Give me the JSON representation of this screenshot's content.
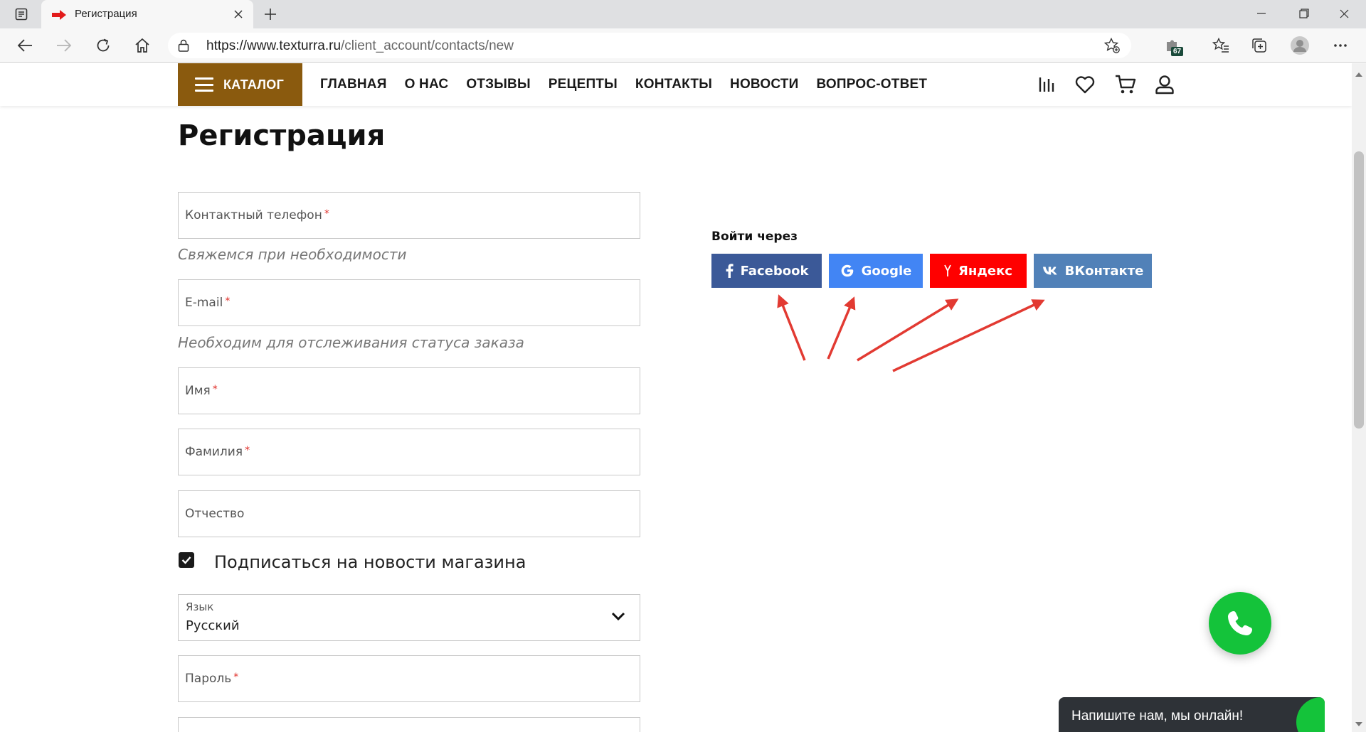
{
  "browser": {
    "tab_title": "Регистрация",
    "url_host": "https://www.texturra.ru",
    "url_path": "/client_account/contacts/new",
    "extension_badge": "67"
  },
  "header": {
    "catalog_label": "КАТАЛОГ",
    "nav": [
      "ГЛАВНАЯ",
      "О НАС",
      "ОТЗЫВЫ",
      "РЕЦЕПТЫ",
      "КОНТАКТЫ",
      "НОВОСТИ",
      "ВОПРОС-ОТВЕТ"
    ],
    "accent_color": "#8a5a0e"
  },
  "page": {
    "title": "Регистрация",
    "form": {
      "phone_placeholder": "Контактный телефон",
      "phone_hint": "Свяжемся при необходимости",
      "email_placeholder": "E-mail",
      "email_hint": "Необходим для отслеживания статуса заказа",
      "first_name_placeholder": "Имя",
      "last_name_placeholder": "Фамилия",
      "middle_name_placeholder": "Отчество",
      "required_mark": "*",
      "subscribe_label": "Подписаться на новости магазина",
      "subscribe_checked": true,
      "language_label": "Язык",
      "language_value": "Русский",
      "password_placeholder": "Пароль"
    },
    "social": {
      "title": "Войти через",
      "buttons": [
        {
          "label": "Facebook",
          "icon": "facebook-icon",
          "color": "#3b5998"
        },
        {
          "label": "Google",
          "icon": "google-icon",
          "color": "#4285f4"
        },
        {
          "label": "Яндекс",
          "icon": "yandex-icon",
          "color": "#ff0000"
        },
        {
          "label": "ВКонтакте",
          "icon": "vk-icon",
          "color": "#5181b8"
        }
      ]
    }
  },
  "widgets": {
    "chat_text": "Напишите нам, мы онлайн!",
    "call_color": "#14c33a",
    "annotation_arrow_color": "#e23a32"
  }
}
